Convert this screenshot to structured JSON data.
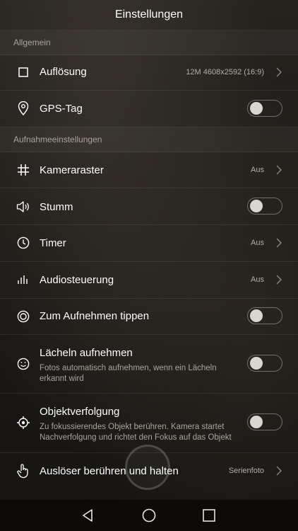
{
  "header": {
    "title": "Einstellungen"
  },
  "sections": {
    "general": "Allgemein",
    "capture": "Aufnahmeeinstellungen"
  },
  "rows": {
    "resolution": {
      "label": "Auflösung",
      "value": "12M 4608x2592 (16:9)"
    },
    "gps": {
      "label": "GPS-Tag",
      "on": false
    },
    "grid": {
      "label": "Kameraraster",
      "value": "Aus"
    },
    "mute": {
      "label": "Stumm",
      "on": false
    },
    "timer": {
      "label": "Timer",
      "value": "Aus"
    },
    "audio": {
      "label": "Audiosteuerung",
      "value": "Aus"
    },
    "tap": {
      "label": "Zum Aufnehmen tippen",
      "on": false
    },
    "smile": {
      "label": "Lächeln aufnehmen",
      "description": "Fotos automatisch aufnehmen, wenn ein Lächeln erkannt wird",
      "on": false
    },
    "tracking": {
      "label": "Objektverfolgung",
      "description": "Zu fokussierendes Objekt berühren. Kamera startet Nachverfolgung und richtet den Fokus auf das Objekt",
      "on": false
    },
    "hold": {
      "label": "Auslöser berühren und halten",
      "value": "Serienfoto"
    }
  },
  "icons": {
    "resolution": "square-icon",
    "gps": "location-pin-icon",
    "grid": "grid-icon",
    "mute": "speaker-icon",
    "timer": "clock-icon",
    "audio": "audio-bars-icon",
    "tap": "target-circle-icon",
    "smile": "smiley-icon",
    "tracking": "crosshair-icon",
    "hold": "hand-touch-icon"
  },
  "navigation": [
    "back-icon",
    "home-icon",
    "recents-icon"
  ]
}
